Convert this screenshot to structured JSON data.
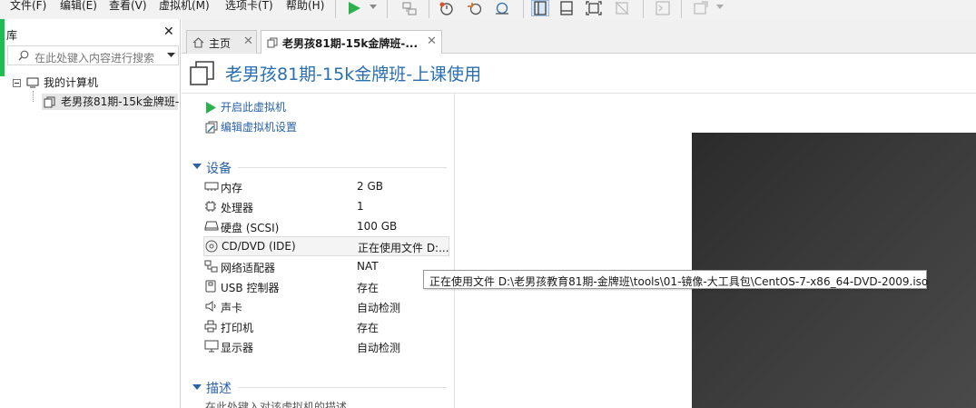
{
  "menu": {
    "items": [
      "文件(F)",
      "编辑(E)",
      "查看(V)",
      "虚拟机(M)",
      "选项卡(T)",
      "帮助(H)"
    ]
  },
  "toolbar": {
    "icons": [
      "play-icon",
      "dropdown-caret-icon",
      "send-keys-icon",
      "snapshot-icon",
      "revert-snapshot-icon",
      "snapshot-manager-icon",
      "library-view-icon",
      "console-view-icon",
      "fullscreen-icon",
      "unity-icon",
      "terminal-icon",
      "stretch-icon"
    ]
  },
  "library": {
    "title": "库",
    "search_placeholder": "在此处键入内容进行搜索",
    "tree": {
      "root": "我的计算机",
      "vm": "老男孩81期-15k金牌班-"
    }
  },
  "tabs": [
    {
      "label": "主页"
    },
    {
      "label": "老男孩81期-15k金牌班-..."
    }
  ],
  "vm": {
    "title": "老男孩81期-15k金牌班-上课使用",
    "actions": {
      "power_on": "开启此虚拟机",
      "edit_settings": "编辑虚拟机设置"
    },
    "sections": {
      "devices": "设备",
      "description": "描述"
    },
    "devices": [
      {
        "name": "内存",
        "value": "2 GB",
        "icon": "memory-icon"
      },
      {
        "name": "处理器",
        "value": "1",
        "icon": "cpu-icon"
      },
      {
        "name": "硬盘 (SCSI)",
        "value": "100 GB",
        "icon": "hard-disk-icon"
      },
      {
        "name": "CD/DVD (IDE)",
        "value": "正在使用文件 D:...",
        "icon": "cd-dvd-icon"
      },
      {
        "name": "网络适配器",
        "value": "NAT",
        "icon": "network-adapter-icon"
      },
      {
        "name": "USB 控制器",
        "value": "存在",
        "icon": "usb-icon"
      },
      {
        "name": "声卡",
        "value": "自动检测",
        "icon": "sound-icon"
      },
      {
        "name": "打印机",
        "value": "存在",
        "icon": "printer-icon"
      },
      {
        "name": "显示器",
        "value": "自动检测",
        "icon": "display-icon"
      }
    ],
    "description_hint": "在此处键入对该虚拟机的描述。"
  },
  "tooltip": {
    "text": "正在使用文件 D:\\老男孩教育81期-金牌班\\tools\\01-镜像-大工具包\\CentOS-7-x86_64-DVD-2009.iso"
  },
  "colors": {
    "accent": "#2a6fb0",
    "link": "#2a62a8",
    "play_green": "#2bb24c",
    "library_stripe": "#1fbe52",
    "preview_bg": "#333333"
  }
}
